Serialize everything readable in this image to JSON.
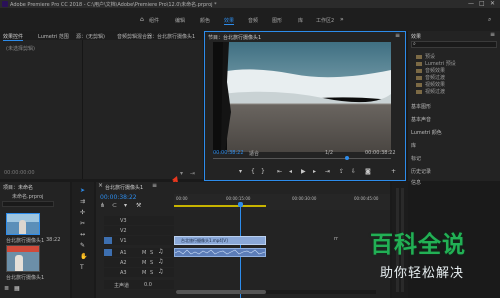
{
  "window": {
    "title": "Adobe Premiere Pro CC 2018 - C:\\用户\\文档\\Adobe\\Premiere Pro\\12.0\\未命名.prproj *"
  },
  "menu": {
    "workspaces": [
      "组件",
      "编辑",
      "颜色",
      "效果",
      "音频",
      "图形",
      "库",
      "工作区2"
    ],
    "active_index": 3
  },
  "source_panel": {
    "tabs": [
      "效果控件",
      "Lumetri 范围",
      "源：(无剪辑)",
      "音频剪辑混合器：台北旅行摄像头1"
    ],
    "empty_label": "(未选择剪辑)",
    "timecode": "00:00:00:00"
  },
  "program_monitor": {
    "tab": "节目：台北旅行摄像头1",
    "timecode_current": "00:00:38:22",
    "zoom": "适合",
    "resolution": "1/2",
    "timecode_total": "00:00:38:22"
  },
  "effects_panel": {
    "title": "效果",
    "search_placeholder": "",
    "tree": [
      "预设",
      "Lumetri 预设",
      "音频效果",
      "音频过渡",
      "视频效果",
      "视频过渡"
    ],
    "sections": [
      "基本图形",
      "基本声音",
      "Lumetri 颜色",
      "库",
      "标记",
      "历史记录",
      "信息"
    ]
  },
  "project_panel": {
    "tab": "项目：未命名",
    "file": "未命名.prproj",
    "count": "",
    "clips": [
      {
        "name": "台北旅行摄像头1",
        "duration": "38:22"
      },
      {
        "name": "台北旅行摄像头1",
        "duration": ""
      }
    ]
  },
  "timeline": {
    "tab": "台北旅行摄像头1",
    "timecode": "00:00:38:22",
    "ruler": [
      "00:00",
      "00:00:15:00",
      "00:00:30:00",
      "00:00:45:00"
    ],
    "video_tracks": [
      "V3",
      "V2",
      "V1"
    ],
    "audio_tracks": [
      "A1",
      "A2",
      "A3"
    ],
    "master": "主声道",
    "master_value": "0.0",
    "video_clip": "台北旅行摄像头1.mp4[V]",
    "clip_note": "rr"
  },
  "watermark": {
    "title": "百科全说",
    "subtitle": "助你轻松解决"
  },
  "colors": {
    "accent": "#2d8ceb",
    "clip": "#8aa8d8",
    "audio_clip": "#5c7db8",
    "arrow": "#e8371e",
    "watermark_green": "#22b055"
  }
}
